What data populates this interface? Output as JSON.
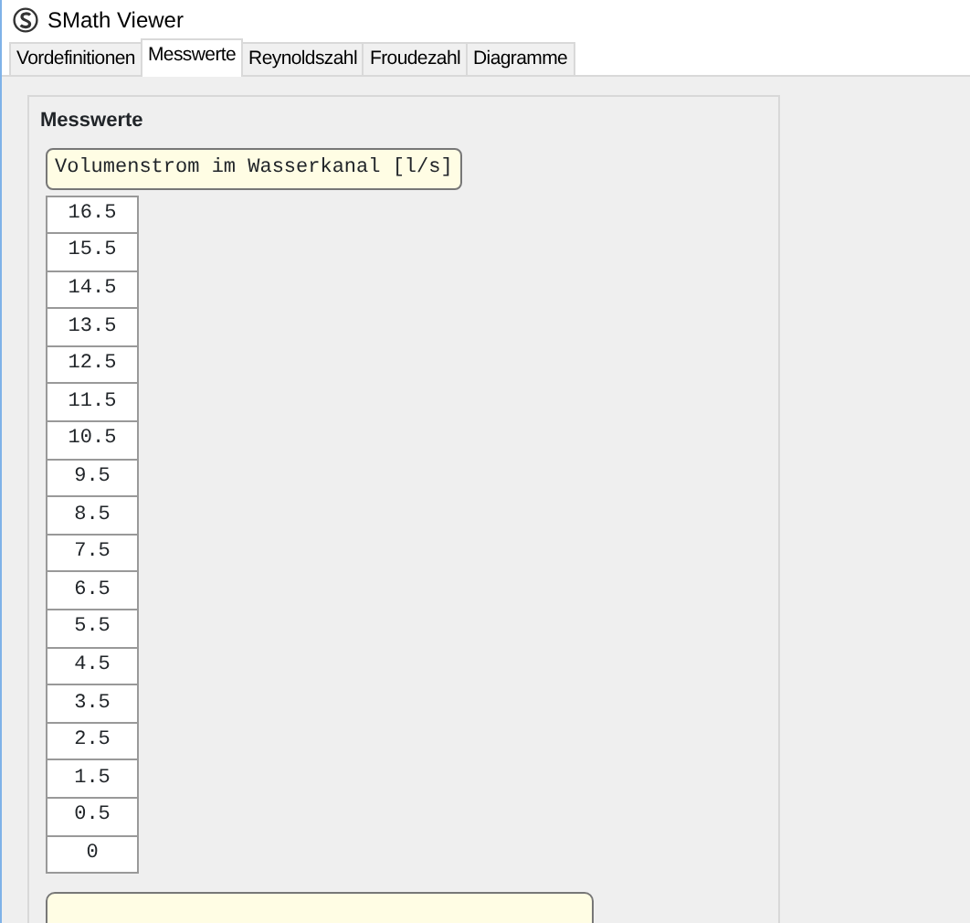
{
  "window": {
    "title": "SMath Viewer"
  },
  "tabs": [
    {
      "label": "Vordefinitionen",
      "selected": false
    },
    {
      "label": "Messwerte",
      "selected": true
    },
    {
      "label": "Reynoldszahl",
      "selected": false
    },
    {
      "label": "Froudezahl",
      "selected": false
    },
    {
      "label": "Diagramme",
      "selected": false
    }
  ],
  "group": {
    "title": "Messwerte",
    "label": "Volumenstrom im Wasserkanal [l/s]",
    "values": [
      "16.5",
      "15.5",
      "14.5",
      "13.5",
      "12.5",
      "11.5",
      "10.5",
      "9.5",
      "8.5",
      "7.5",
      "6.5",
      "5.5",
      "4.5",
      "3.5",
      "2.5",
      "1.5",
      "0.5",
      "0"
    ]
  }
}
